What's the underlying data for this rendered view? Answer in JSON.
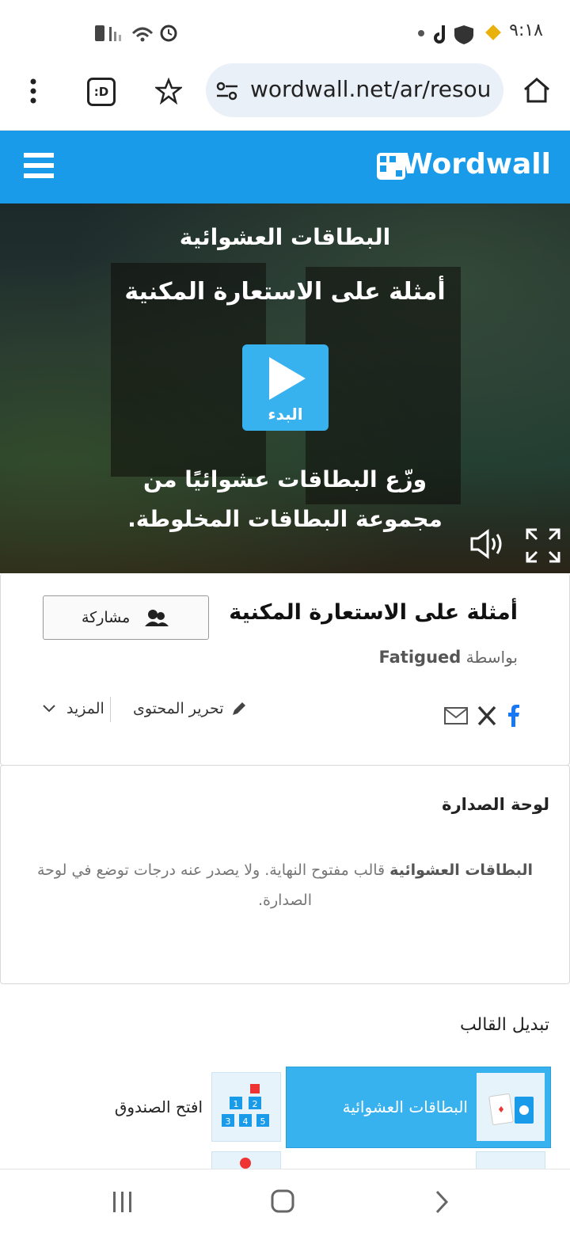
{
  "status_bar": {
    "time": "٩:١٨"
  },
  "browser": {
    "url": "wordwall.net/ar/resou"
  },
  "header": {
    "logo": "Wordwall"
  },
  "game": {
    "template_name": "البطاقات العشوائية",
    "activity_title": "أمثلة على الاستعارة المكنية",
    "start_label": "البدء",
    "description_line1": "وزّع البطاقات عشوائيًا من",
    "description_line2": "مجموعة البطاقات المخلوطة."
  },
  "activity": {
    "title": "أمثلة على الاستعارة المكنية",
    "by_label": "بواسطة",
    "author": "Fatigued",
    "share_label": "مشاركة",
    "edit_label": "تحرير المحتوى",
    "more_label": "المزيد"
  },
  "leaderboard": {
    "heading": "لوحة الصدارة",
    "bold_part": "البطاقات العشوائية",
    "text_line1": " قالب مفتوح النهاية. ولا يصدر عنه درجات توضع في لوحة",
    "text_line2": "الصدارة."
  },
  "switch_template": {
    "heading": "تبديل القالب",
    "items": [
      {
        "label": "البطاقات العشوائية",
        "selected": true
      },
      {
        "label": "افتح الصندوق",
        "selected": false
      }
    ]
  },
  "colors": {
    "brand": "#1a9bea",
    "selected_tile": "#38b1ef",
    "play": "#38b1ef"
  }
}
